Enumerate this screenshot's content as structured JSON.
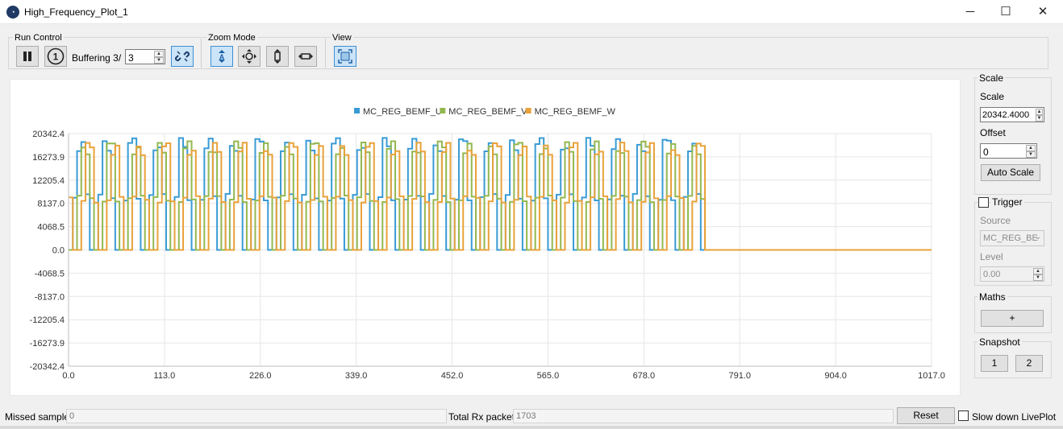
{
  "window": {
    "title": "High_Frequency_Plot_1",
    "minimize": "─",
    "maximize": "☐",
    "close": "✕"
  },
  "toolbar": {
    "run_control_label": "Run Control",
    "buffering_label": "Buffering",
    "buffering_value": "3/",
    "buffering_spin_value": "3",
    "zoom_mode_label": "Zoom Mode",
    "view_label": "View"
  },
  "sidebar": {
    "scale_group_title": "Scale",
    "scale_label": "Scale",
    "scale_value": "20342.4000",
    "offset_label": "Offset",
    "offset_value": "0",
    "auto_scale_label": "Auto Scale",
    "trigger_label": "Trigger",
    "source_label": "Source",
    "source_value": "MC_REG_BE",
    "level_label": "Level",
    "level_value": "0.00",
    "maths_title": "Maths",
    "maths_add_label": "+",
    "snapshot_title": "Snapshot",
    "snapshot_1_label": "1",
    "snapshot_2_label": "2"
  },
  "status": {
    "missed_samples_label": "Missed samples",
    "missed_samples_value": "0",
    "total_rx_label": "Total Rx packets",
    "total_rx_value": "1703",
    "reset_label": "Reset",
    "slowdown_label": "Slow down LivePlot"
  },
  "chart_data": {
    "type": "line",
    "title": "",
    "xlabel": "",
    "ylabel": "",
    "xlim": [
      0,
      1017
    ],
    "ylim": [
      -20342.4,
      20342.4
    ],
    "x_ticks": [
      "0.0",
      "113.0",
      "226.0",
      "339.0",
      "452.0",
      "565.0",
      "678.0",
      "791.0",
      "904.0",
      "1017.0"
    ],
    "y_ticks": [
      "20342.4",
      "16273.9",
      "12205.4",
      "8137.0",
      "4068.5",
      "0.0",
      "-4068.5",
      "-8137.0",
      "-12205.4",
      "-16273.9",
      "-20342.4"
    ],
    "grid": true,
    "legend_position": "top-center",
    "data_end_x": 750,
    "series": [
      {
        "name": "MC_REG_BEMF_U",
        "color": "#3a9bd5",
        "high": 19600,
        "mid": 9800,
        "low": 0,
        "pattern": [
          0,
          1,
          2,
          2,
          1,
          0
        ],
        "step": 5,
        "phase": 0
      },
      {
        "name": "MC_REG_BEMF_V",
        "color": "#93b850",
        "high": 19000,
        "mid": 9500,
        "low": 0,
        "pattern": [
          1,
          0,
          0,
          1,
          2,
          2
        ],
        "step": 5,
        "phase": 1
      },
      {
        "name": "MC_REG_BEMF_W",
        "color": "#e9a23a",
        "high": 18800,
        "mid": 9400,
        "low": 0,
        "pattern": [
          2,
          2,
          1,
          0,
          0,
          1
        ],
        "step": 5,
        "phase": 2
      }
    ],
    "hold_after_end": 0
  }
}
